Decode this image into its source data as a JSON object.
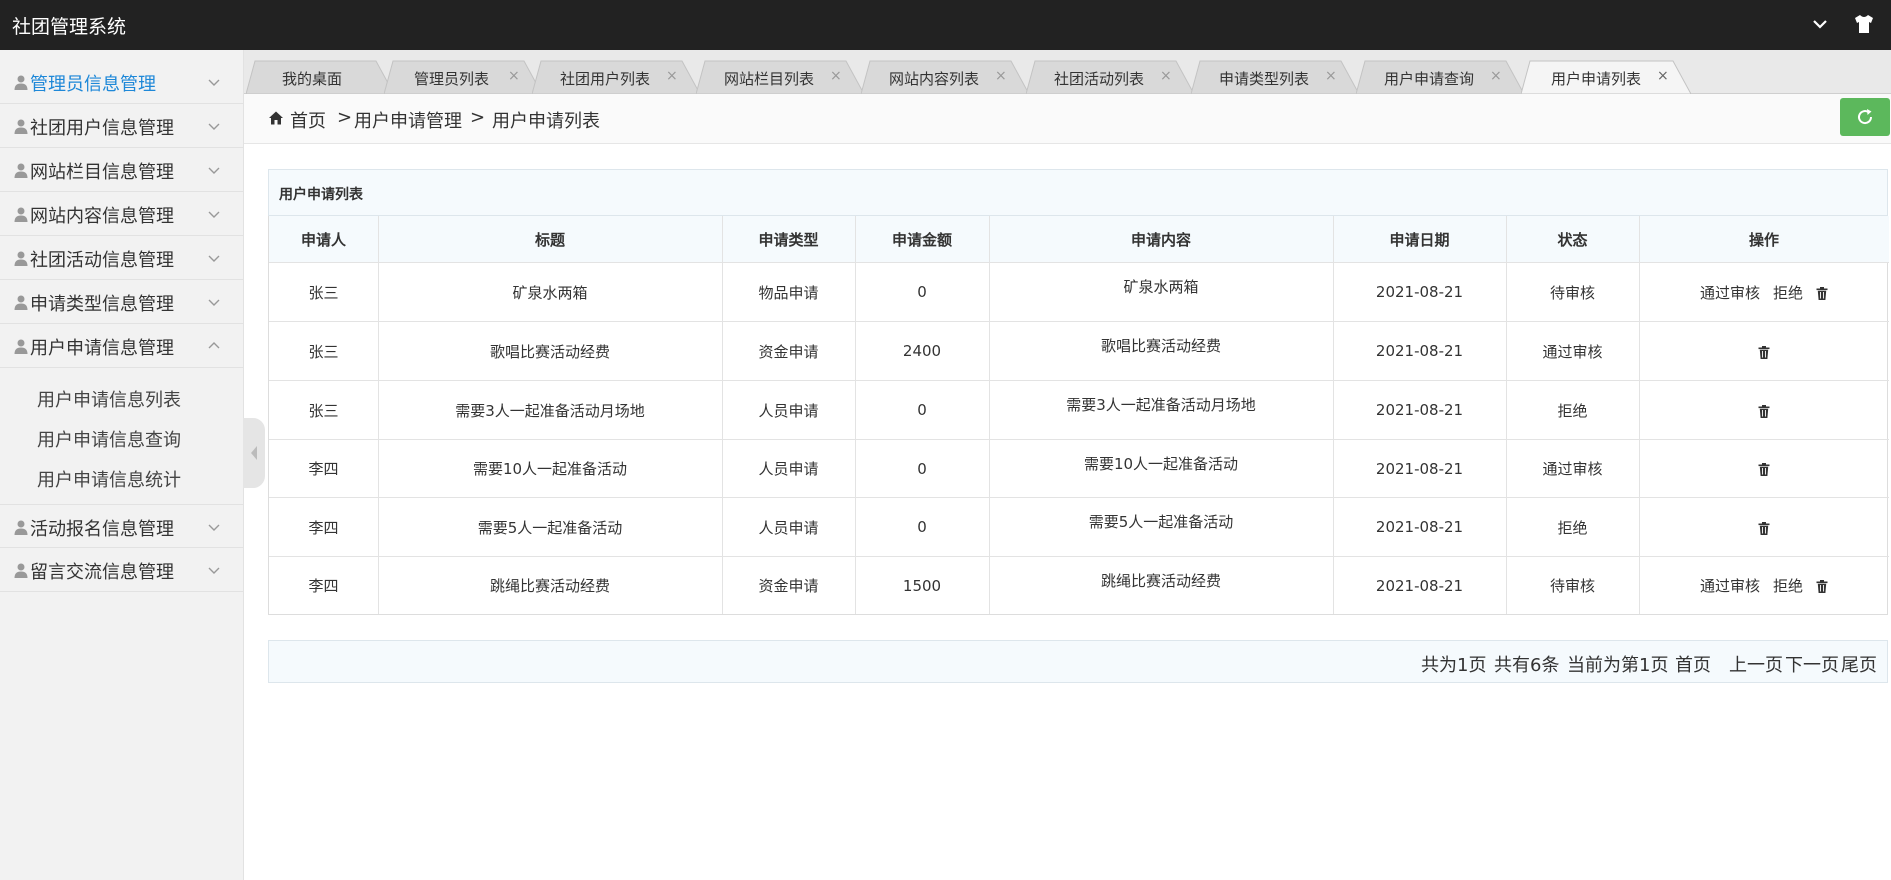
{
  "app": {
    "title": "社团管理系统"
  },
  "topbar": {
    "icons": [
      "chevron-down-icon",
      "tshirt-icon"
    ]
  },
  "sidebar": {
    "items": [
      {
        "label": "管理员信息管理",
        "active": true
      },
      {
        "label": "社团用户信息管理"
      },
      {
        "label": "网站栏目信息管理"
      },
      {
        "label": "网站内容信息管理"
      },
      {
        "label": "社团活动信息管理"
      },
      {
        "label": "申请类型信息管理"
      },
      {
        "label": "用户申请信息管理",
        "expanded": true
      },
      {
        "label": "活动报名信息管理"
      },
      {
        "label": "留言交流信息管理"
      }
    ],
    "submenu": [
      {
        "label": "用户申请信息列表"
      },
      {
        "label": "用户申请信息查询"
      },
      {
        "label": "用户申请信息统计"
      }
    ]
  },
  "tabs": [
    {
      "label": "我的桌面"
    },
    {
      "label": "管理员列表",
      "close": "×"
    },
    {
      "label": "社团用户列表",
      "close": "×"
    },
    {
      "label": "网站栏目列表",
      "close": "×"
    },
    {
      "label": "网站内容列表",
      "close": "×"
    },
    {
      "label": "社团活动列表",
      "close": "×"
    },
    {
      "label": "申请类型列表",
      "close": "×"
    },
    {
      "label": "用户申请查询",
      "close": "×"
    },
    {
      "label": "用户申请列表",
      "close": "×",
      "active": true
    }
  ],
  "breadcrumb": {
    "home": "首页",
    "sep": ">",
    "level1": "用户申请管理",
    "level2": "用户申请列表"
  },
  "panel": {
    "title": "用户申请列表"
  },
  "table": {
    "headers": [
      "申请人",
      "标题",
      "申请类型",
      "申请金额",
      "申请内容",
      "申请日期",
      "状态",
      "操作"
    ],
    "rows": [
      {
        "applicant": "张三",
        "title": "矿泉水两箱",
        "type": "物品申请",
        "amount": "0",
        "content": "矿泉水两箱",
        "date": "2021-08-21",
        "status": "待审核",
        "approve": "通过审核",
        "reject": "拒绝"
      },
      {
        "applicant": "张三",
        "title": "歌唱比赛活动经费",
        "type": "资金申请",
        "amount": "2400",
        "content": "歌唱比赛活动经费",
        "date": "2021-08-21",
        "status": "通过审核",
        "approve": "",
        "reject": ""
      },
      {
        "applicant": "张三",
        "title": "需要3人一起准备活动月场地",
        "type": "人员申请",
        "amount": "0",
        "content": "需要3人一起准备活动月场地",
        "date": "2021-08-21",
        "status": "拒绝",
        "approve": "",
        "reject": ""
      },
      {
        "applicant": "李四",
        "title": "需要10人一起准备活动",
        "type": "人员申请",
        "amount": "0",
        "content": "需要10人一起准备活动",
        "date": "2021-08-21",
        "status": "通过审核",
        "approve": "",
        "reject": ""
      },
      {
        "applicant": "李四",
        "title": "需要5人一起准备活动",
        "type": "人员申请",
        "amount": "0",
        "content": "需要5人一起准备活动",
        "date": "2021-08-21",
        "status": "拒绝",
        "approve": "",
        "reject": ""
      },
      {
        "applicant": "李四",
        "title": "跳绳比赛活动经费",
        "type": "资金申请",
        "amount": "1500",
        "content": "跳绳比赛活动经费",
        "date": "2021-08-21",
        "status": "待审核",
        "approve": "通过审核",
        "reject": "拒绝"
      }
    ]
  },
  "pager": {
    "total_pages": "共为1页",
    "total_items": "共有6条",
    "current": "当前为第1页",
    "first": "首页",
    "prev": "上一页",
    "next": "下一页",
    "last": "尾页"
  },
  "colors": {
    "topbar": "#222222",
    "accent": "#1e88d8",
    "refresh": "#5cb85c"
  }
}
